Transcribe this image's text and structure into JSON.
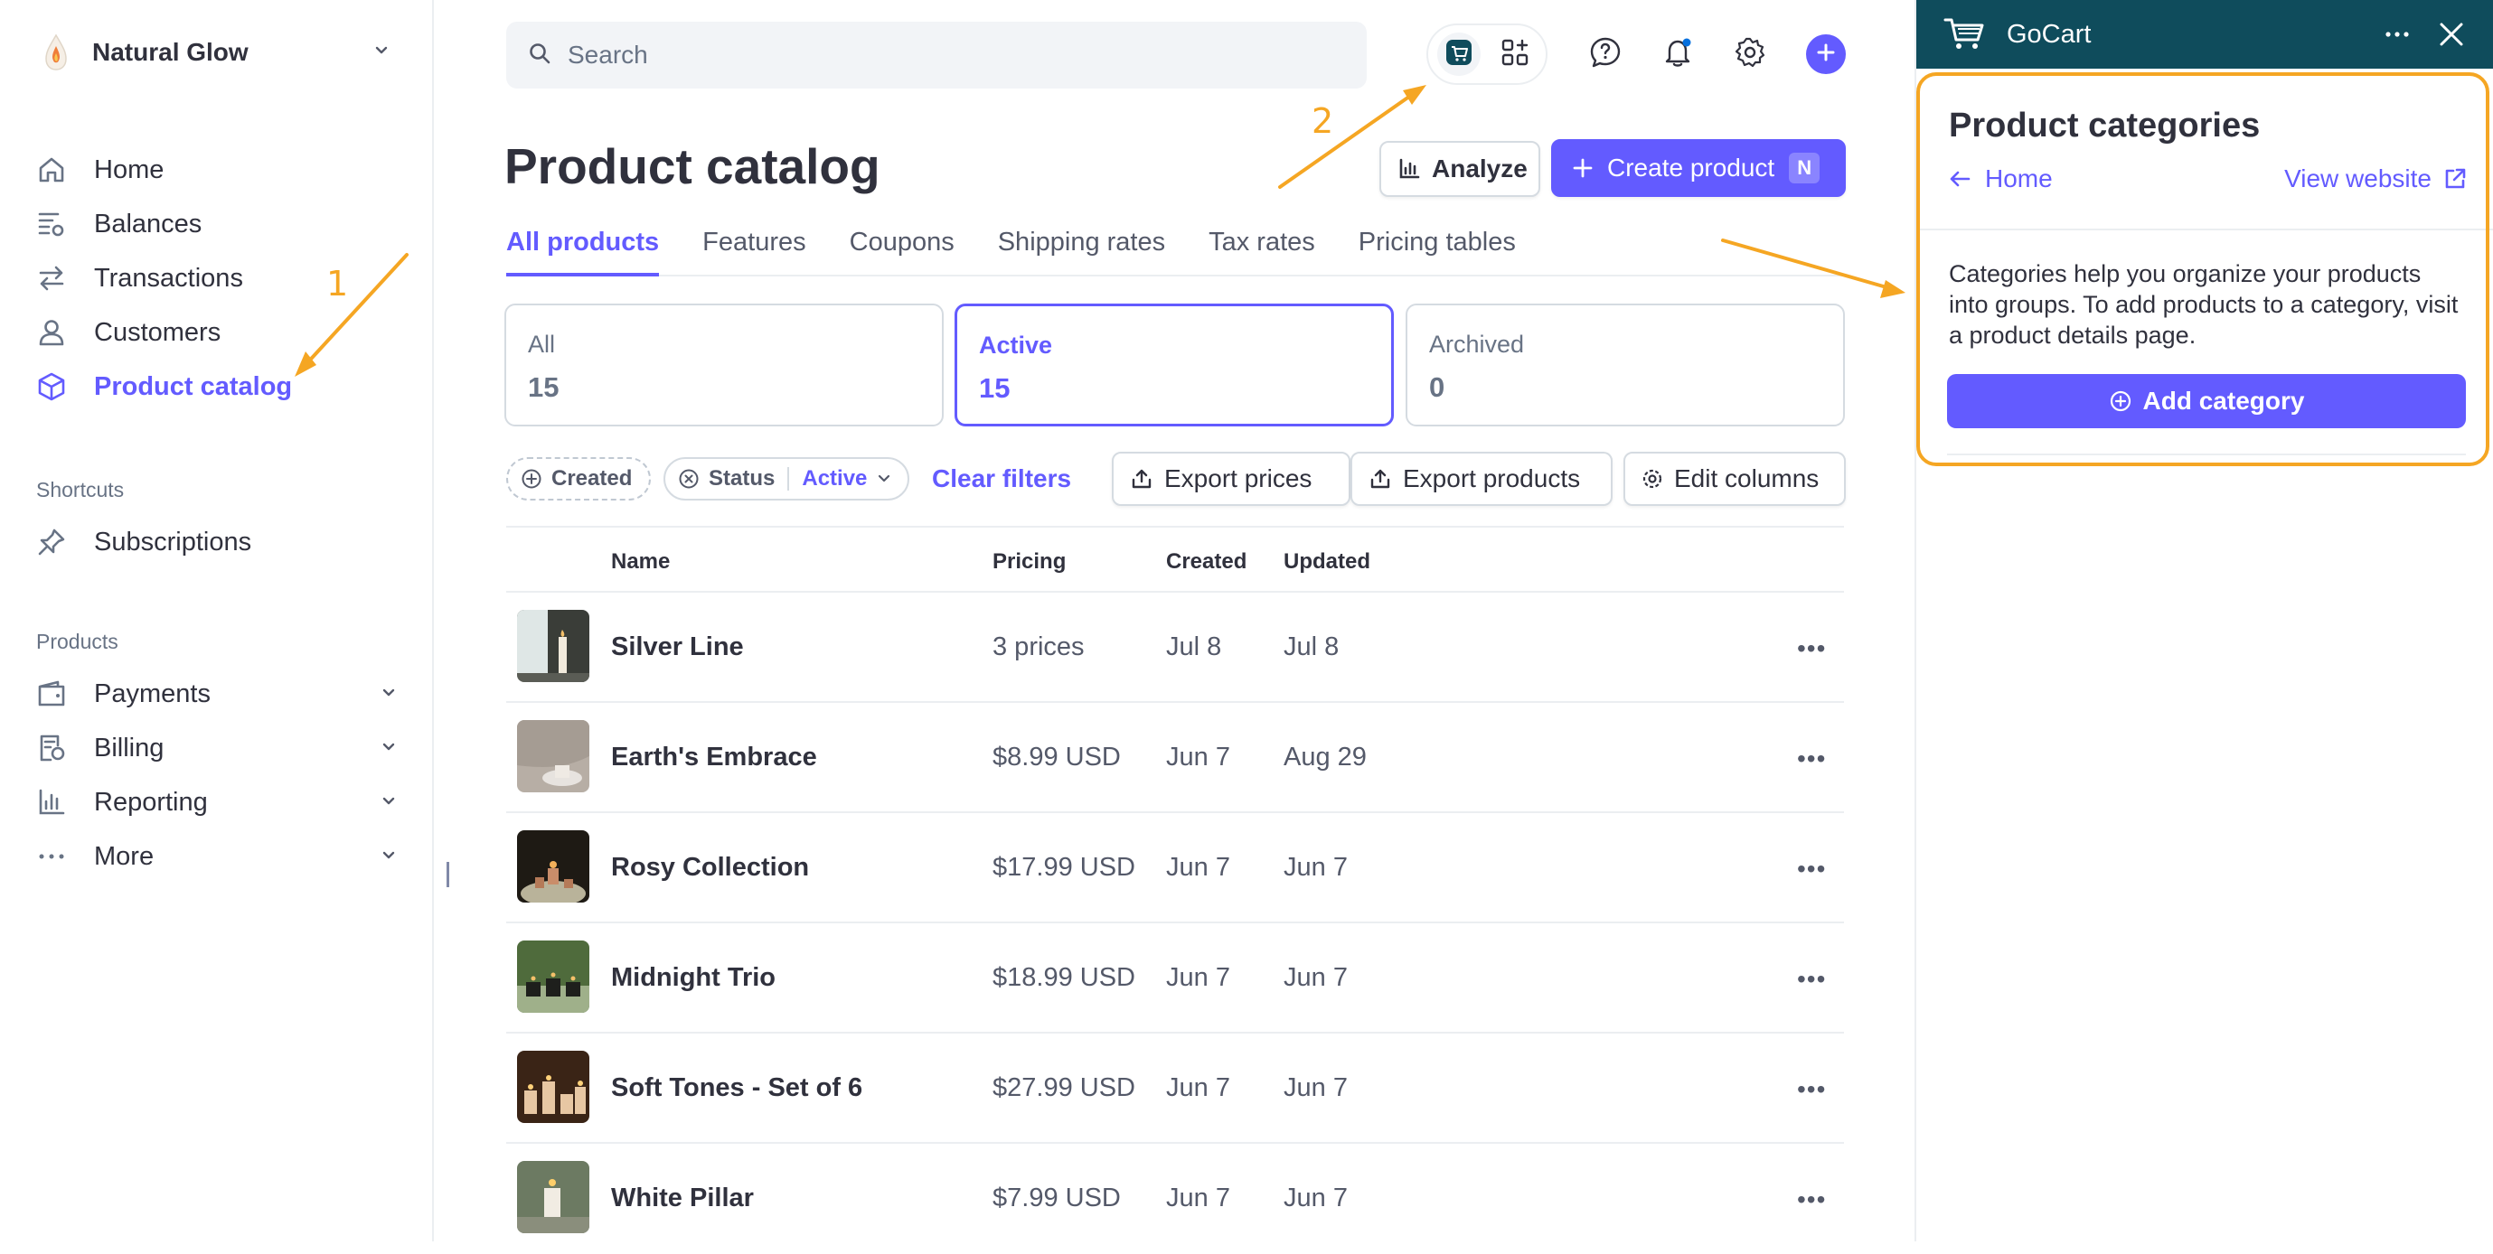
{
  "sidebar": {
    "account_name": "Natural Glow",
    "nav": [
      {
        "label": "Home",
        "icon": "home-icon"
      },
      {
        "label": "Balances",
        "icon": "balances-icon"
      },
      {
        "label": "Transactions",
        "icon": "transactions-icon"
      },
      {
        "label": "Customers",
        "icon": "customers-icon"
      },
      {
        "label": "Product catalog",
        "icon": "cube-icon",
        "active": true
      }
    ],
    "shortcuts_label": "Shortcuts",
    "shortcuts": [
      {
        "label": "Subscriptions",
        "icon": "pin-icon"
      }
    ],
    "products_label": "Products",
    "products": [
      {
        "label": "Payments",
        "icon": "wallet-icon"
      },
      {
        "label": "Billing",
        "icon": "billing-icon"
      },
      {
        "label": "Reporting",
        "icon": "reporting-icon"
      },
      {
        "label": "More",
        "icon": "more-icon"
      }
    ]
  },
  "topbar": {
    "search_placeholder": "Search"
  },
  "page": {
    "title": "Product catalog",
    "analyze_label": "Analyze",
    "create_label": "Create product",
    "create_shortcut": "N",
    "tabs": [
      "All products",
      "Features",
      "Coupons",
      "Shipping rates",
      "Tax rates",
      "Pricing tables"
    ],
    "active_tab": "All products",
    "stats": [
      {
        "label": "All",
        "value": "15"
      },
      {
        "label": "Active",
        "value": "15",
        "active": true
      },
      {
        "label": "Archived",
        "value": "0"
      }
    ],
    "filters": {
      "created": "Created",
      "status": "Status",
      "status_value": "Active",
      "clear": "Clear filters"
    },
    "actions": {
      "export_prices": "Export prices",
      "export_products": "Export products",
      "edit_columns": "Edit columns"
    }
  },
  "table": {
    "columns": [
      "Name",
      "Pricing",
      "Created",
      "Updated"
    ],
    "rows": [
      {
        "name": "Silver Line",
        "pricing": "3 prices",
        "created": "Jul 8",
        "updated": "Jul 8"
      },
      {
        "name": "Earth's Embrace",
        "pricing": "$8.99 USD",
        "created": "Jun 7",
        "updated": "Aug 29"
      },
      {
        "name": "Rosy Collection",
        "pricing": "$17.99 USD",
        "created": "Jun 7",
        "updated": "Jun 7"
      },
      {
        "name": "Midnight Trio",
        "pricing": "$18.99 USD",
        "created": "Jun 7",
        "updated": "Jun 7"
      },
      {
        "name": "Soft Tones - Set of 6",
        "pricing": "$27.99 USD",
        "created": "Jun 7",
        "updated": "Jun 7"
      },
      {
        "name": "White Pillar",
        "pricing": "$7.99 USD",
        "created": "Jun 7",
        "updated": "Jun 7"
      }
    ]
  },
  "panel": {
    "app_name": "GoCart",
    "title": "Product categories",
    "home_link": "Home",
    "view_website": "View website",
    "description": "Categories help you organize your products into groups. To add products to a category, visit a product details page.",
    "add_label": "Add category"
  },
  "annotations": [
    "1",
    "2"
  ],
  "colors": {
    "accent": "#635bff",
    "panel_header": "#0f4c5c",
    "annotation": "#f5a623",
    "text": "#30313d"
  }
}
